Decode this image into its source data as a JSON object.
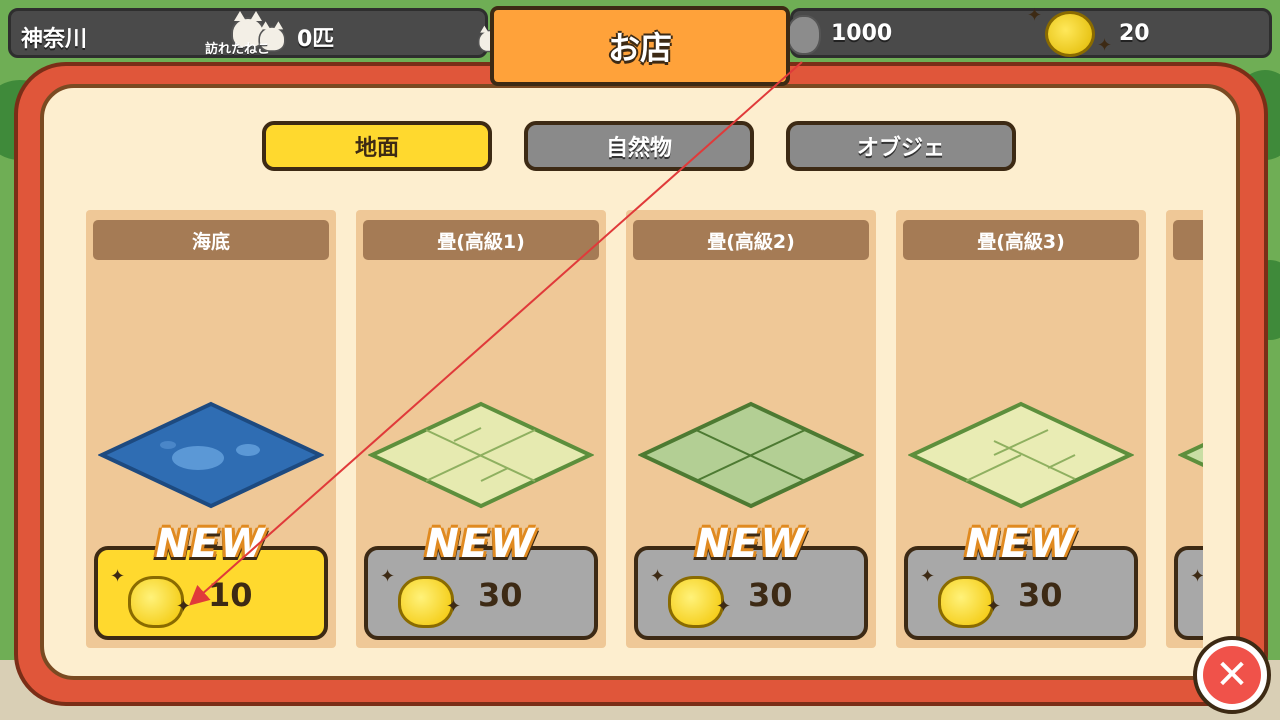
{
  "hud": {
    "location": "神奈川",
    "visitors_count": "0匹",
    "visitors_label": "訪れたねこ",
    "currency_amount": "1000",
    "gold_amount": "20"
  },
  "shop": {
    "title": "お店",
    "tabs": [
      {
        "label": "地面",
        "active": true
      },
      {
        "label": "自然物",
        "active": false
      },
      {
        "label": "オブジェ",
        "active": false
      }
    ],
    "items": [
      {
        "name": "海底",
        "badge": "NEW",
        "price": "10",
        "selected": true,
        "tile_color": "#2f6db3"
      },
      {
        "name": "畳(高級1)",
        "badge": "NEW",
        "price": "30",
        "selected": false,
        "tile_color": "#e6eab0"
      },
      {
        "name": "畳(高級2)",
        "badge": "NEW",
        "price": "30",
        "selected": false,
        "tile_color": "#b3cf94"
      },
      {
        "name": "畳(高級3)",
        "badge": "NEW",
        "price": "30",
        "selected": false,
        "tile_color": "#e9ecb4"
      }
    ],
    "close_icon": "close-icon"
  },
  "colors": {
    "panel_red": "#e0563a",
    "panel_cream": "#fdeecf",
    "tab_active": "#ffd92e",
    "tab_inactive": "#8a8a8a",
    "title_orange": "#ffa23a",
    "arrow": "#e03a3a"
  }
}
